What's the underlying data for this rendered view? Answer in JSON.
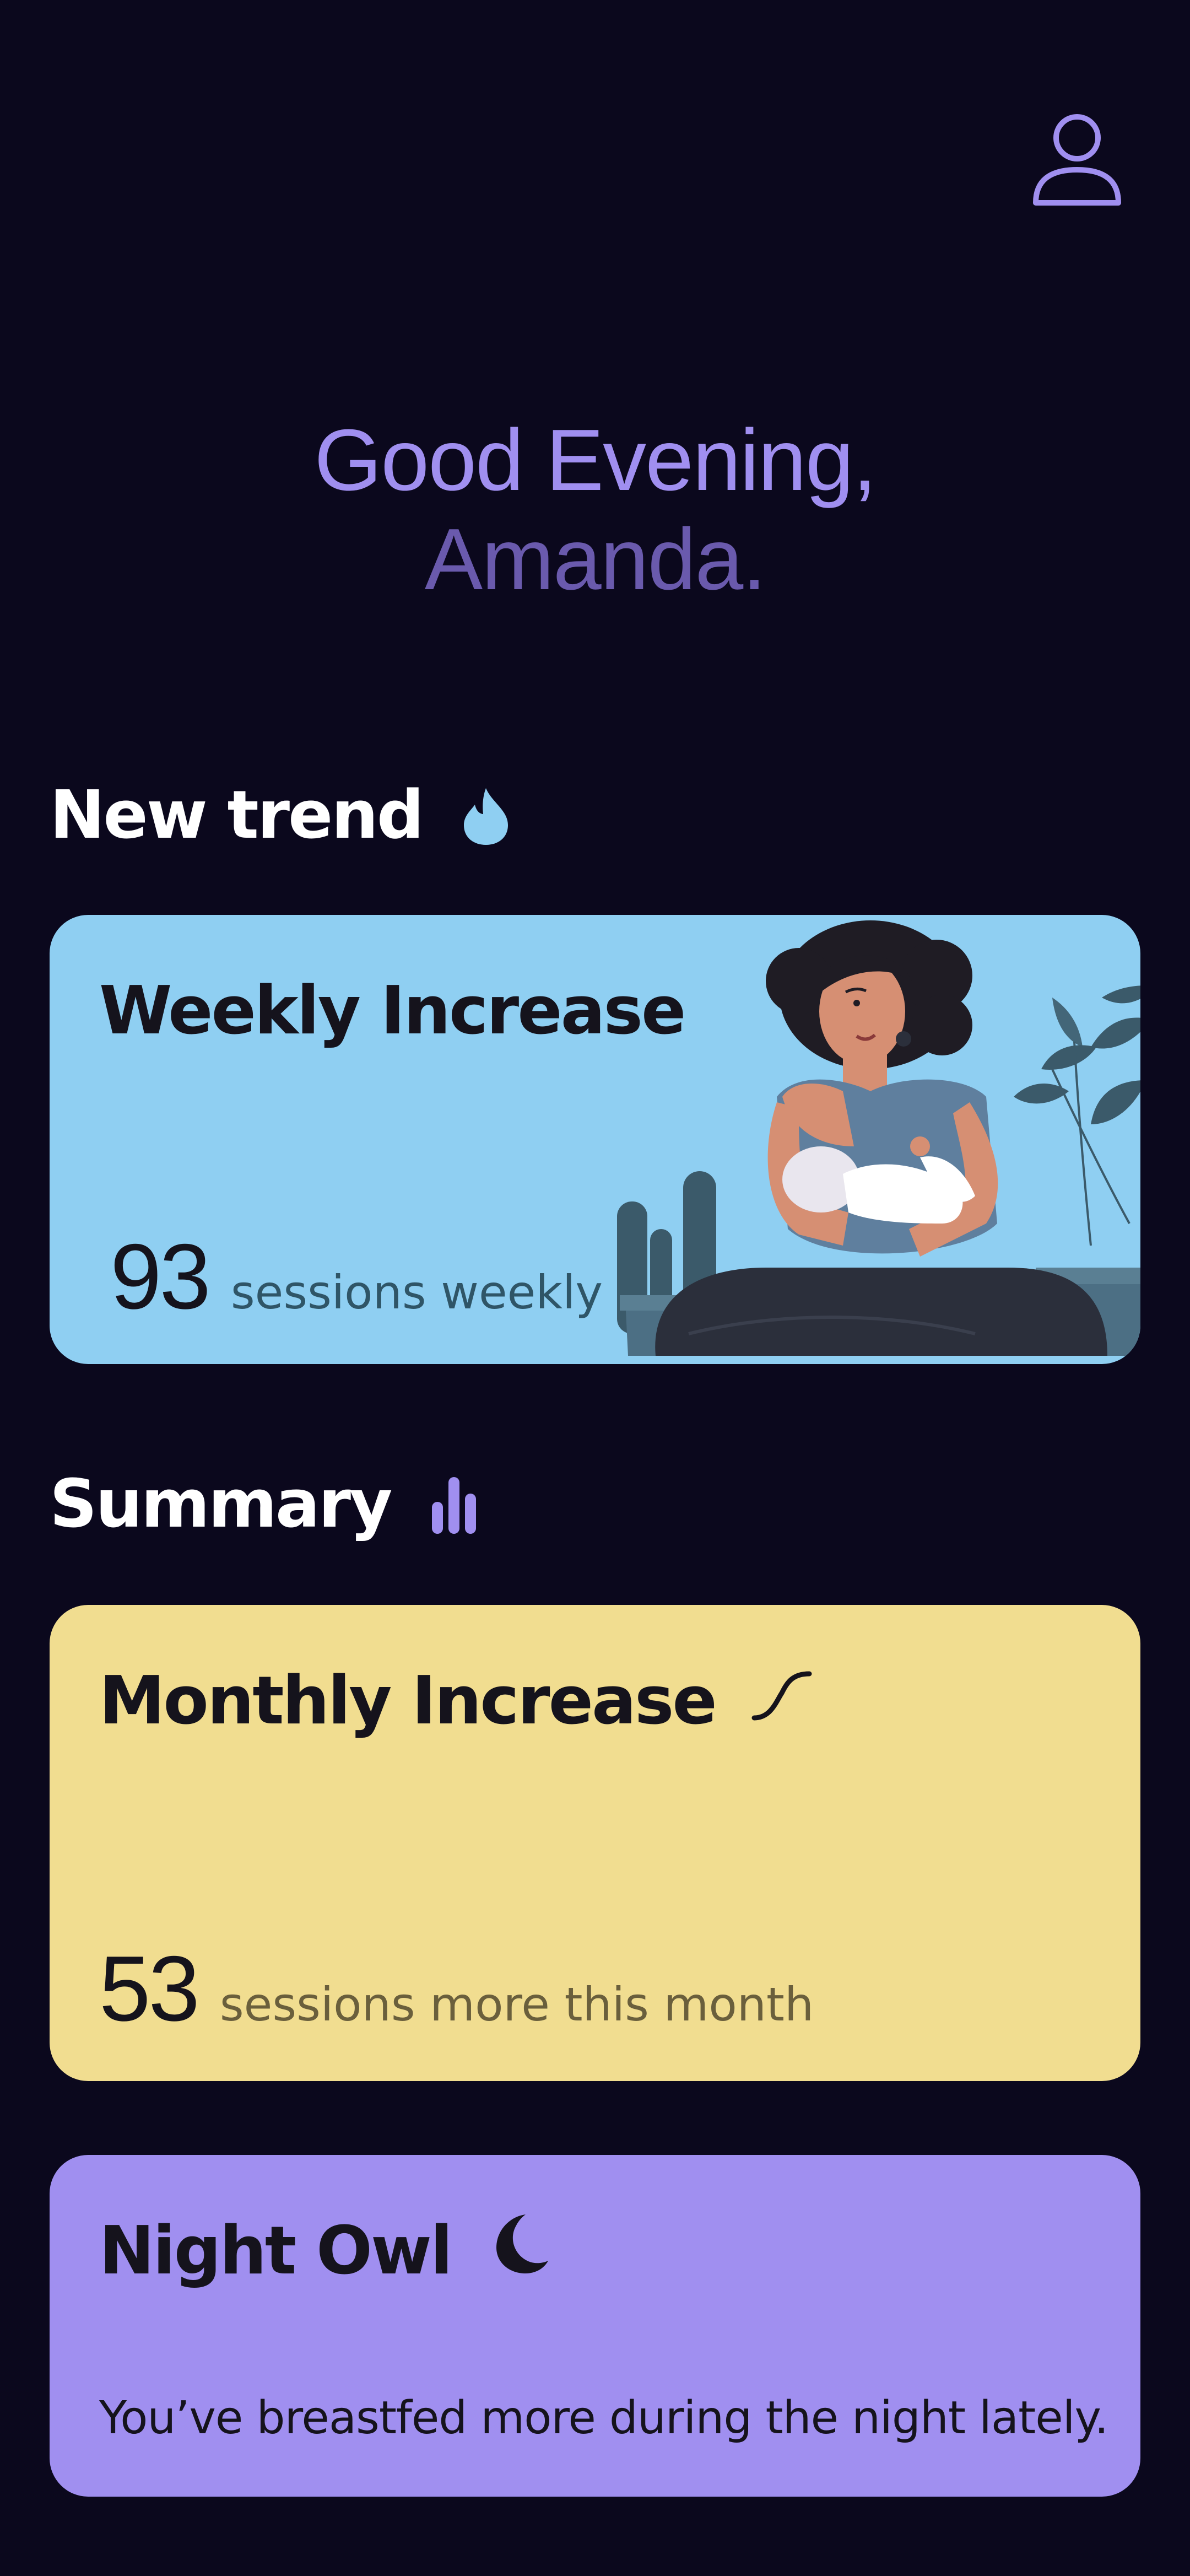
{
  "greeting": {
    "line1": "Good Evening,",
    "line2": "Amanda."
  },
  "profile": {
    "icon": "user-icon",
    "color": "#a08ff0"
  },
  "sections": {
    "trend": {
      "heading": "New trend",
      "icon": "flame-icon"
    },
    "summary": {
      "heading": "Summary",
      "icon": "bar-chart-icon"
    }
  },
  "cards": {
    "weekly": {
      "title": "Weekly Increase",
      "value": "93",
      "label": "sessions weekly",
      "color": "#8fcff2",
      "illustration": "breastfeeding-mother-illustration"
    },
    "monthly": {
      "title": "Monthly Increase",
      "title_icon": "trend-curve-icon",
      "value": "53",
      "label": "sessions more this month",
      "color": "#f1dd90"
    },
    "night": {
      "title": "Night Owl",
      "title_icon": "moon-icon",
      "description": "You’ve breastfed more during the night lately.",
      "color": "#a08ff0"
    }
  },
  "colors": {
    "background": "#0b081d",
    "accent": "#a08ff0",
    "accent_dim": "#6a5aad",
    "flame": "#8fcff2"
  }
}
